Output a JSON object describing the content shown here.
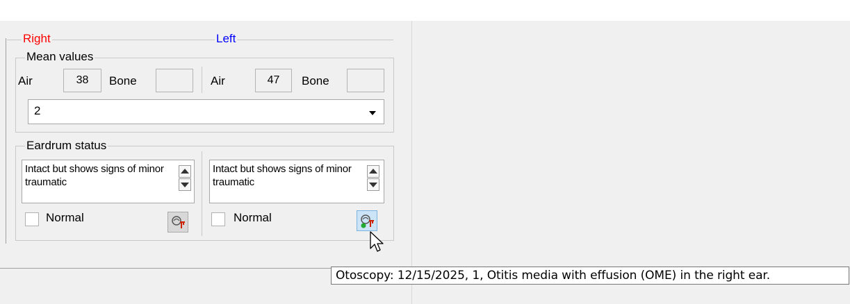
{
  "headers": {
    "right": "Right",
    "left": "Left"
  },
  "colors": {
    "right_header": "#ff0000",
    "left_header": "#0000ff"
  },
  "mean_values": {
    "title": "Mean values",
    "right": {
      "air_label": "Air",
      "air_value": "38",
      "bone_label": "Bone",
      "bone_value": ""
    },
    "left": {
      "air_label": "Air",
      "air_value": "47",
      "bone_label": "Bone",
      "bone_value": ""
    },
    "dropdown_value": "2"
  },
  "eardrum": {
    "title": "Eardrum status",
    "right": {
      "text": "Intact but shows signs of minor traumatic",
      "normal_label": "Normal",
      "normal_checked": false,
      "icon": "otoscope-icon"
    },
    "left": {
      "text": "Intact but shows signs of minor traumatic",
      "normal_label": "Normal",
      "normal_checked": false,
      "icon": "otoscope-icon"
    }
  },
  "tooltip": {
    "text": "Otoscopy: 12/15/2025, 1, Otitis media with effusion (OME) in the right ear."
  }
}
